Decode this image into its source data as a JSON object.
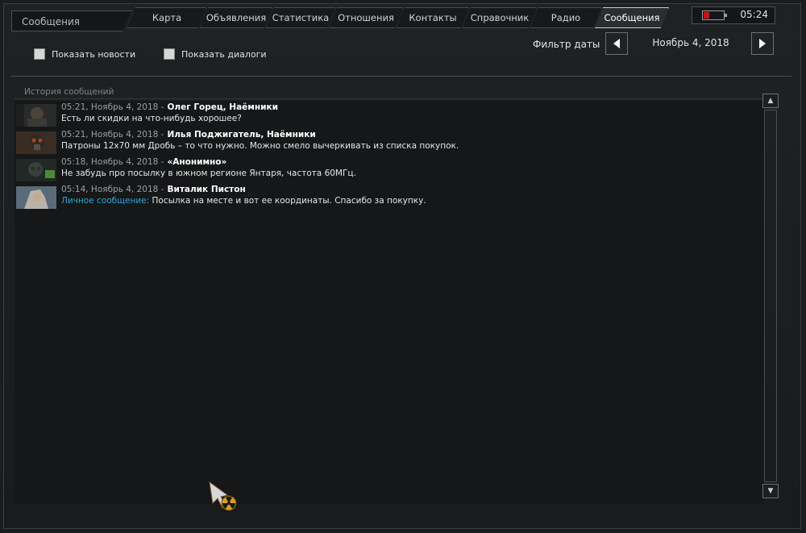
{
  "window": {
    "title": "Сообщения"
  },
  "tabs": [
    {
      "label": "Карта",
      "active": false
    },
    {
      "label": "Объявления",
      "active": false
    },
    {
      "label": "Статистика",
      "active": false
    },
    {
      "label": "Отношения",
      "active": false
    },
    {
      "label": "Контакты",
      "active": false
    },
    {
      "label": "Справочник",
      "active": false
    },
    {
      "label": "Радио",
      "active": false
    },
    {
      "label": "Сообщения",
      "active": true
    }
  ],
  "status": {
    "time": "05:24",
    "battery_level": 0.3,
    "battery_color": "#c01818"
  },
  "filters": {
    "show_news": "Показать новости",
    "show_dialogs": "Показать диалоги",
    "date_filter_label": "Фильтр даты",
    "date_value": "Ноябрь 4, 2018"
  },
  "history": {
    "header": "История сообщений",
    "messages": [
      {
        "time": "05:21, Ноябрь 4, 2018 -",
        "author": "Олег Горец, Наёмники",
        "prefix": "",
        "text": "Есть ли скидки на что-нибудь хорошее?",
        "avatar": "mercenary-avatar"
      },
      {
        "time": "05:21, Ноябрь 4, 2018 -",
        "author": "Илья Поджигатель, Наёмники",
        "prefix": "",
        "text": "Патроны 12х70 мм Дробь – то что нужно. Можно смело вычеркивать из списка покупок.",
        "avatar": "gasmask-avatar"
      },
      {
        "time": "05:18, Ноябрь 4, 2018 -",
        "author": "«Анонимно»",
        "prefix": "",
        "text": "Не забудь про посылку в южном регионе Янтаря, частота 60МГц.",
        "avatar": "anonymous-avatar"
      },
      {
        "time": "05:14, Ноябрь 4, 2018 -",
        "author": "Виталик Пистон",
        "prefix": "Личное сообщение:",
        "text": " Посылка на месте и вот ее координаты. Спасибо за покупку.",
        "avatar": "stalker-avatar"
      }
    ]
  },
  "colors": {
    "private_message": "#2aa8d8",
    "active_tab_border": "#c8ccce"
  }
}
